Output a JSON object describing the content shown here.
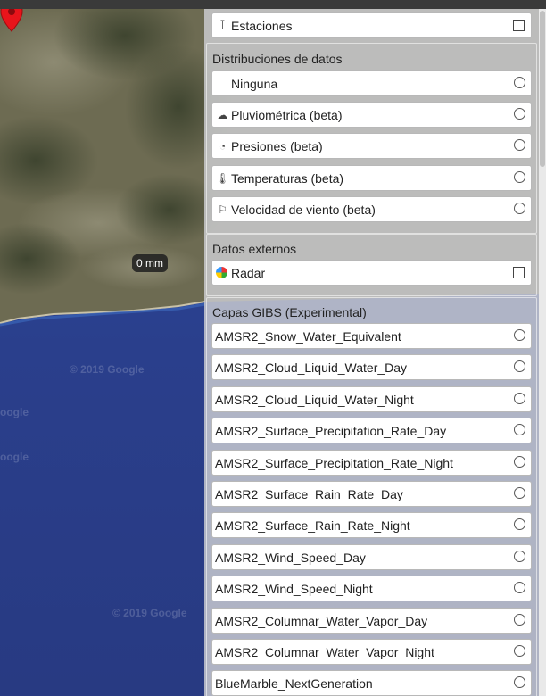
{
  "map": {
    "watermark": "© 2019 Google",
    "watermark_short": "oogle",
    "tooltip": "0 mm"
  },
  "panel": {
    "stations": {
      "label": "Estaciones",
      "icon": "antenna-icon",
      "checked": false
    },
    "distributions": {
      "title": "Distribuciones de datos",
      "options": [
        {
          "label": "Ninguna",
          "icon": ""
        },
        {
          "label": "Pluviométrica (beta)",
          "icon": "rain-cloud-icon"
        },
        {
          "label": "Presiones (beta)",
          "icon": "gauge-icon"
        },
        {
          "label": "Temperaturas (beta)",
          "icon": "thermometer-icon"
        },
        {
          "label": "Velocidad de viento (beta)",
          "icon": "windsock-icon"
        }
      ]
    },
    "external": {
      "title": "Datos externos",
      "radar": {
        "label": "Radar",
        "icon": "radar-icon",
        "checked": false
      }
    },
    "gibs": {
      "title": "Capas GIBS (Experimental)",
      "layers": [
        "AMSR2_Snow_Water_Equivalent",
        "AMSR2_Cloud_Liquid_Water_Day",
        "AMSR2_Cloud_Liquid_Water_Night",
        "AMSR2_Surface_Precipitation_Rate_Day",
        "AMSR2_Surface_Precipitation_Rate_Night",
        "AMSR2_Surface_Rain_Rate_Day",
        "AMSR2_Surface_Rain_Rate_Night",
        "AMSR2_Wind_Speed_Day",
        "AMSR2_Wind_Speed_Night",
        "AMSR2_Columnar_Water_Vapor_Day",
        "AMSR2_Columnar_Water_Vapor_Night",
        "BlueMarble_NextGeneration"
      ]
    }
  },
  "colors": {
    "pin": "#e8141b",
    "sea": "#2b3f86",
    "land": "#6a6a4e"
  }
}
